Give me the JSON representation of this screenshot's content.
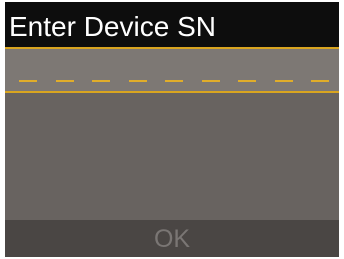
{
  "header": {
    "title": "Enter Device SN"
  },
  "serial_entry": {
    "slot_count": 9,
    "value": ""
  },
  "footer": {
    "ok_label": "OK"
  },
  "colors": {
    "title_bar": "#0d0d0d",
    "body": "#686360",
    "entry_band": "#7d7874",
    "accent_gold": "#d9a520",
    "footer": "#4a4644",
    "ok_disabled_text": "#7a7674"
  }
}
